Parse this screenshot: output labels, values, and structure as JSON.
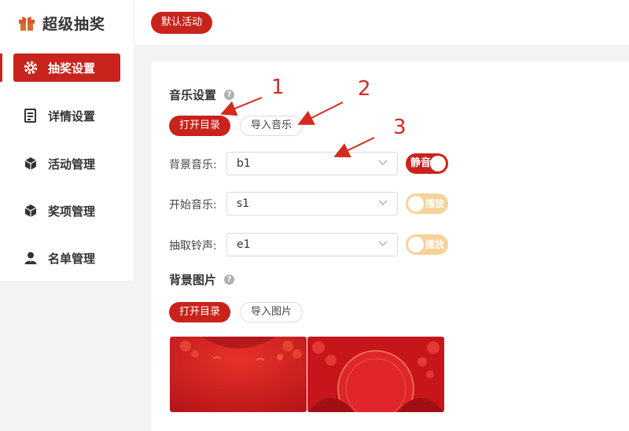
{
  "header": {
    "app_title": "超级抽奖",
    "activity_pill": "默认活动",
    "icon": "gift-icon"
  },
  "sidebar": {
    "items": [
      {
        "label": "抽奖设置",
        "icon": "gear-icon",
        "active": true
      },
      {
        "label": "详情设置",
        "icon": "document-icon",
        "active": false
      },
      {
        "label": "活动管理",
        "icon": "box-icon",
        "active": false
      },
      {
        "label": "奖项管理",
        "icon": "box-icon",
        "active": false
      },
      {
        "label": "名单管理",
        "icon": "user-icon",
        "active": false
      }
    ]
  },
  "music": {
    "title": "音乐设置",
    "open_dir_label": "打开目录",
    "import_label": "导入音乐",
    "rows": [
      {
        "label": "背景音乐:",
        "value": "b1",
        "toggle_label": "静音",
        "toggle_on": true
      },
      {
        "label": "开始音乐:",
        "value": "s1",
        "toggle_label": "播放",
        "toggle_on": false
      },
      {
        "label": "抽取铃声:",
        "value": "e1",
        "toggle_label": "播放",
        "toggle_on": false
      }
    ]
  },
  "background": {
    "title": "背景图片",
    "open_dir_label": "打开目录",
    "import_label": "导入图片"
  },
  "annotations": [
    "1",
    "2",
    "3"
  ],
  "colors": {
    "accent": "#c8231c",
    "toggle_off": "#f7d29a",
    "annotation": "#d42a20"
  }
}
